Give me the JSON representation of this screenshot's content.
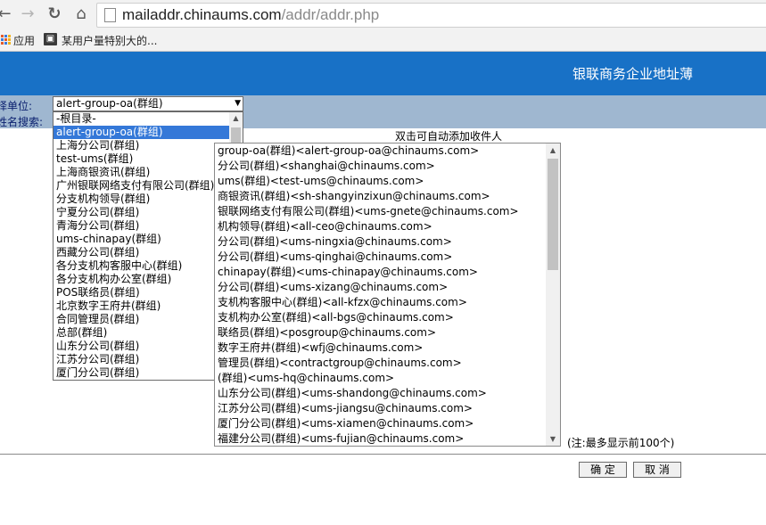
{
  "browser": {
    "url_host": "mailaddr.chinaums.com",
    "url_path": "/addr/addr.php",
    "bookmarks": {
      "apps_label": "应用",
      "bookmark_1": "某用户量特别大的..."
    }
  },
  "header": {
    "title": "银联商务企业地址薄"
  },
  "filters": {
    "unit_label": "择单位:",
    "search_label": "姓名搜索:",
    "unit_selected": "alert-group-oa(群组)"
  },
  "unit_options": [
    "-根目录-",
    "alert-group-oa(群组)",
    "上海分公司(群组)",
    "test-ums(群组)",
    "上海商银资讯(群组)",
    "广州银联网络支付有限公司(群组)",
    "分支机构领导(群组)",
    "宁夏分公司(群组)",
    "青海分公司(群组)",
    "ums-chinapay(群组)",
    "西藏分公司(群组)",
    "各分支机构客服中心(群组)",
    "各分支机构办公室(群组)",
    "POS联络员(群组)",
    "北京数字王府井(群组)",
    "合同管理员(群组)",
    "总部(群组)",
    "山东分公司(群组)",
    "江苏分公司(群组)",
    "厦门分公司(群组)"
  ],
  "recipients": {
    "hint": "双击可自动添加收件人",
    "items": [
      "group-oa(群组)<alert-group-oa@chinaums.com>",
      "分公司(群组)<shanghai@chinaums.com>",
      "ums(群组)<test-ums@chinaums.com>",
      "商银资讯(群组)<sh-shangyinzixun@chinaums.com>",
      "银联网络支付有限公司(群组)<ums-gnete@chinaums.com>",
      "机构领导(群组)<all-ceo@chinaums.com>",
      "分公司(群组)<ums-ningxia@chinaums.com>",
      "分公司(群组)<ums-qinghai@chinaums.com>",
      "chinapay(群组)<ums-chinapay@chinaums.com>",
      "分公司(群组)<ums-xizang@chinaums.com>",
      "支机构客服中心(群组)<all-kfzx@chinaums.com>",
      "支机构办公室(群组)<all-bgs@chinaums.com>",
      "联络员(群组)<posgroup@chinaums.com>",
      "数字王府井(群组)<wfj@chinaums.com>",
      "管理员(群组)<contractgroup@chinaums.com>",
      "(群组)<ums-hq@chinaums.com>",
      "山东分公司(群组)<ums-shandong@chinaums.com>",
      "江苏分公司(群组)<ums-jiangsu@chinaums.com>",
      "厦门分公司(群组)<ums-xiamen@chinaums.com>",
      "福建分公司(群组)<ums-fujian@chinaums.com>"
    ],
    "note": "(注:最多显示前100个)"
  },
  "buttons": {
    "ok": "确 定",
    "cancel": "取 消"
  },
  "icons": {
    "back": "back-arrow-icon",
    "forward": "forward-arrow-icon",
    "reload": "reload-icon",
    "home": "home-icon",
    "page": "page-icon",
    "apps": "apps-grid-icon"
  },
  "colors": {
    "banner": "#1871c6",
    "filter_area": "#9fb7d0",
    "selection": "#3478d8"
  }
}
